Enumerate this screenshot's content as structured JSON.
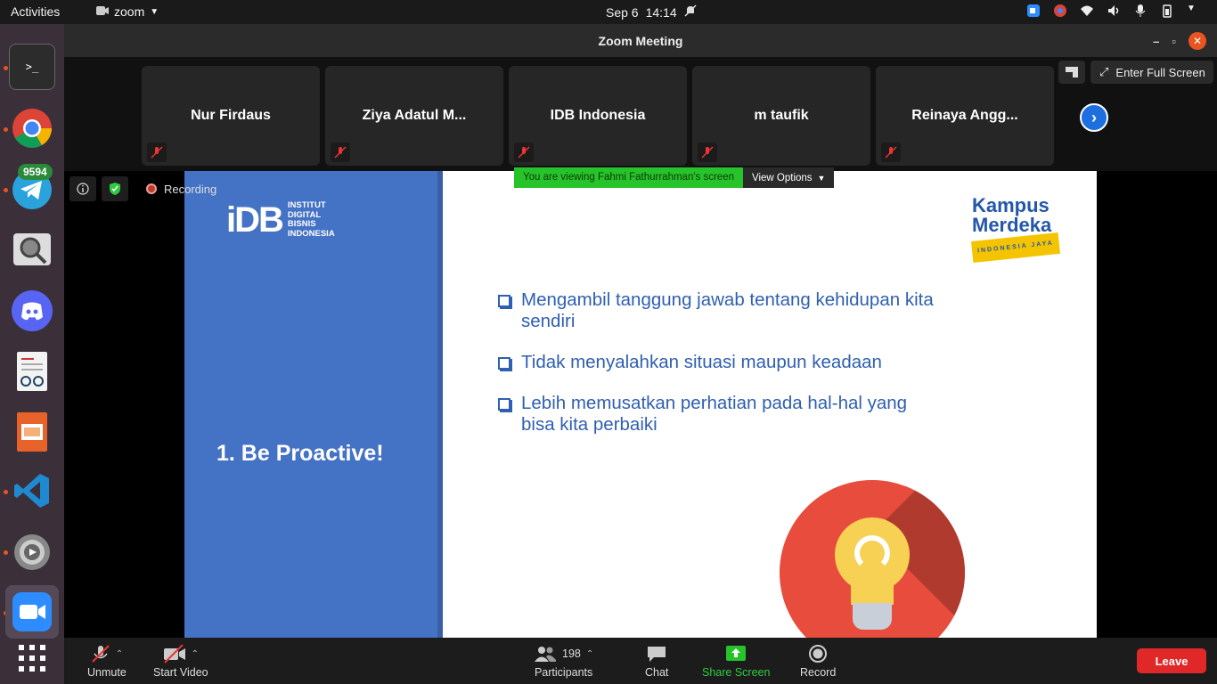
{
  "topbar": {
    "activities": "Activities",
    "app_name": "zoom",
    "date": "Sep 6",
    "time": "14:14"
  },
  "dock": {
    "telegram_badge": "9594",
    "icons": [
      "terminal-icon",
      "chrome-icon",
      "telegram-icon",
      "image-viewer-icon",
      "discord-icon",
      "document-viewer-icon",
      "presentation-icon",
      "vscode-icon",
      "settings-icon",
      "zoom-icon",
      "app-grid-icon"
    ]
  },
  "window": {
    "title": "Zoom Meeting",
    "fullscreen_label": "Enter Full Screen"
  },
  "participants_strip": [
    {
      "name": "Nur Firdaus"
    },
    {
      "name": "Ziya Adatul M..."
    },
    {
      "name": "IDB Indonesia"
    },
    {
      "name": "m taufik"
    },
    {
      "name": "Reinaya Angg..."
    }
  ],
  "meeting_status": {
    "recording_label": "Recording"
  },
  "share_banner": {
    "message": "You are viewing Fahmi Fathurrahman's screen",
    "options_label": "View Options"
  },
  "slide": {
    "logo_big": "iDB",
    "logo_lines": [
      "INSTITUT",
      "DIGITAL",
      "BISNIS",
      "INDONESIA"
    ],
    "title": "1. Be Proactive!",
    "kampus_line1": "Kampus",
    "kampus_line2": "Merdeka",
    "kampus_tag": "INDONESIA JAYA",
    "bullets": [
      "Mengambil tanggung jawab tentang kehidupan kita sendiri",
      "Tidak menyalahkan situasi maupun keadaan",
      "Lebih memusatkan perhatian pada hal-hal yang bisa kita perbaiki"
    ]
  },
  "toolbar": {
    "unmute": "Unmute",
    "start_video": "Start Video",
    "participants_count": "198",
    "participants": "Participants",
    "chat": "Chat",
    "share_screen": "Share Screen",
    "record": "Record",
    "leave": "Leave"
  },
  "colors": {
    "share_green": "#27c32a",
    "leave_red": "#e02828",
    "slide_blue": "#4472c4",
    "accent_blue": "#1d6fe0"
  }
}
